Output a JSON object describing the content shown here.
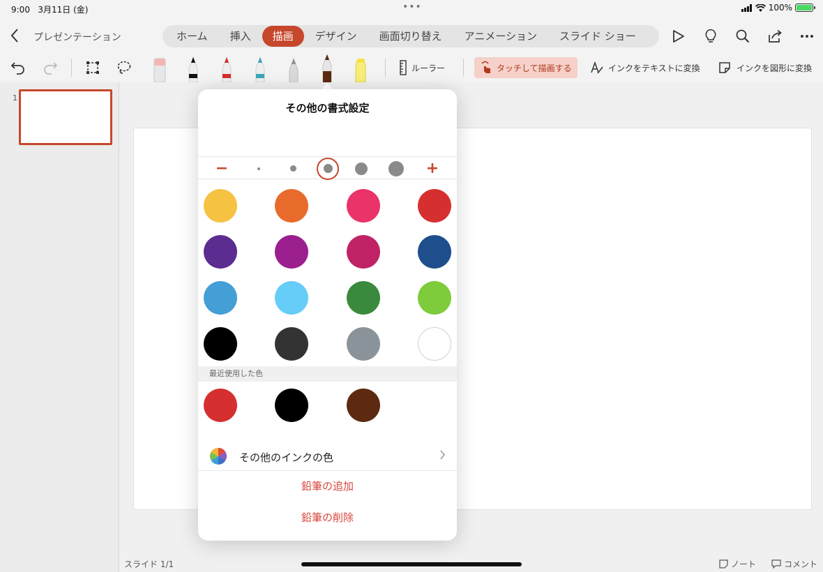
{
  "status_bar": {
    "time": "9:00",
    "date": "3月11日 (金)",
    "center_dots": "•••",
    "battery_percent": "100%",
    "icons": [
      "cellular-icon",
      "wifi-icon",
      "battery-charging-icon"
    ]
  },
  "header": {
    "back_icon": "chevron-left-icon",
    "doc_title": "プレゼンテーション",
    "tabs": [
      {
        "label": "ホーム"
      },
      {
        "label": "挿入"
      },
      {
        "label": "描画",
        "active": true
      },
      {
        "label": "デザイン"
      },
      {
        "label": "画面切り替え"
      },
      {
        "label": "アニメーション"
      },
      {
        "label": "スライド ショー"
      }
    ],
    "right_icons": [
      "play-icon",
      "lightbulb-icon",
      "search-icon",
      "share-icon",
      "more-icon"
    ]
  },
  "toolbar": {
    "icons": [
      "undo-icon",
      "redo-icon",
      "select-rect-icon",
      "lasso-icon",
      "eraser-icon"
    ],
    "pens": [
      {
        "name": "pen-black",
        "color": "#111111"
      },
      {
        "name": "pen-red",
        "color": "#d62f2f"
      },
      {
        "name": "pen-teal",
        "color": "#3aa6b9"
      },
      {
        "name": "pencil-gray",
        "color": "#8a8f96"
      },
      {
        "name": "pencil-brown",
        "color": "#5c2a10",
        "selected": true
      },
      {
        "name": "highlighter-yellow",
        "color": "#f4e33a"
      }
    ],
    "ruler_label": "ルーラー",
    "touch_draw_label": "タッチして描画する",
    "ink_to_text_label": "インクをテキストに変換",
    "ink_to_shape_label": "インクを図形に変換"
  },
  "slides_pane": {
    "slide_number": "1"
  },
  "footer": {
    "slide_count": "スライド 1/1",
    "notes_label": "ノート",
    "comments_label": "コメント"
  },
  "popover": {
    "title": "その他の書式設定",
    "minus_label": "−",
    "plus_label": "+",
    "sizes": [
      4,
      9,
      13,
      18,
      22
    ],
    "selected_size_index": 2,
    "colors": [
      "#f5c242",
      "#e86b2c",
      "#ea3369",
      "#d62f2f",
      "#5b2d91",
      "#9b1f8f",
      "#c02365",
      "#1f4e8c",
      "#439fd6",
      "#66ccf8",
      "#3a8a3d",
      "#7ecb3b",
      "#000000",
      "#333333",
      "#8a9399",
      "#ffffff"
    ],
    "recent_label": "最近使用した色",
    "recent_colors": [
      "#d62f2f",
      "#000000",
      "#5c2a10"
    ],
    "more_ink_colors_label": "その他のインクの色",
    "add_pencil_label": "鉛筆の追加",
    "remove_pencil_label": "鉛筆の削除",
    "accent": "#c6472b"
  }
}
